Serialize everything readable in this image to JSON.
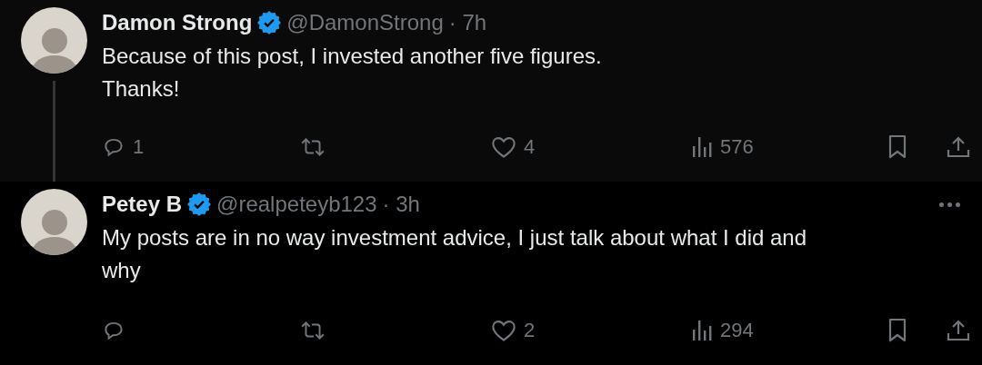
{
  "tweets": [
    {
      "kind": "parent",
      "name": "Damon Strong",
      "verified": true,
      "handle": "@DamonStrong",
      "time": "· 7h",
      "text": "Because of this post, I invested another five figures.\nThanks!",
      "stats": {
        "replies": "1",
        "likes": "4",
        "views": "576"
      }
    },
    {
      "kind": "reply",
      "name": "Petey B",
      "verified": true,
      "handle": "@realpeteyb123",
      "time": "· 3h",
      "text": "My posts are in no way investment advice, I just talk about what I did and\nwhy",
      "more_menu": true,
      "stats": {
        "likes": "2",
        "views": "294"
      }
    }
  ]
}
